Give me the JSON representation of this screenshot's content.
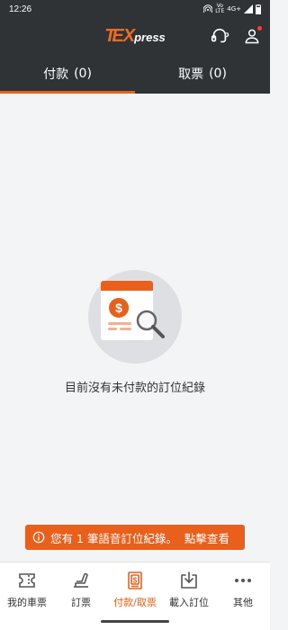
{
  "status_bar": {
    "time": "12:26",
    "network_top": "Vo",
    "network_bottom": "LTE",
    "network": "4G+"
  },
  "header": {
    "logo": {
      "t": "T",
      "ex": "EX",
      "press": "press"
    },
    "actions": [
      "headset-icon",
      "profile-icon"
    ]
  },
  "tabs": [
    {
      "label": "付款",
      "count": "(0)",
      "active": true
    },
    {
      "label": "取票",
      "count": "(0)",
      "active": false
    }
  ],
  "empty_state": {
    "message": "目前沒有未付款的訂位紀錄"
  },
  "voice_notice": {
    "text": "您有 1 筆語音訂位紀錄。",
    "link": "點擊查看"
  },
  "bottom_nav": [
    {
      "label": "我的車票",
      "icon": "ticket-icon",
      "active": false
    },
    {
      "label": "訂票",
      "icon": "seat-icon",
      "active": false
    },
    {
      "label": "付款/取票",
      "icon": "payment-icon",
      "active": true
    },
    {
      "label": "載入訂位",
      "icon": "download-icon",
      "active": false
    },
    {
      "label": "其他",
      "icon": "more-icon",
      "active": false
    }
  ],
  "colors": {
    "accent": "#e8601c",
    "header_bg": "#2f3336",
    "page_bg": "#f3f4f6"
  }
}
